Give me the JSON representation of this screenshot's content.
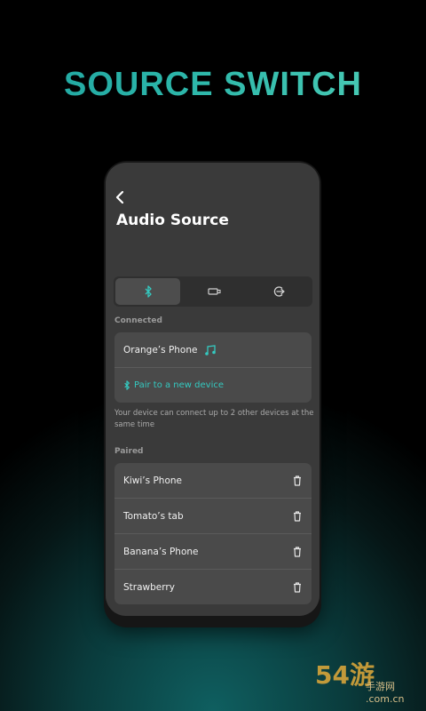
{
  "hero": {
    "title": "SOURCE SWITCH"
  },
  "screen": {
    "back_icon": "chevron-left-icon",
    "title": "Audio Source",
    "tabs": [
      {
        "icon": "bluetooth-icon",
        "active": true
      },
      {
        "icon": "usb-icon",
        "active": false
      },
      {
        "icon": "input-icon",
        "active": false
      }
    ],
    "connected_label": "Connected",
    "connected_device": "Orange’s Phone",
    "music_icon": "music-note-icon",
    "pair_label": "Pair to a new device",
    "note": "Your device can connect up to 2 other devices at the same time",
    "paired_label": "Paired",
    "paired_devices": [
      {
        "name": "Kiwi’s Phone"
      },
      {
        "name": "Tomato’s tab"
      },
      {
        "name": "Banana’s Phone"
      },
      {
        "name": "Strawberry"
      }
    ]
  },
  "watermark": {
    "text": "54游",
    "sub": "手游网 .com.cn"
  },
  "colors": {
    "accent": "#34c9c0",
    "background": "#000000",
    "card": "#4a4a4a"
  }
}
